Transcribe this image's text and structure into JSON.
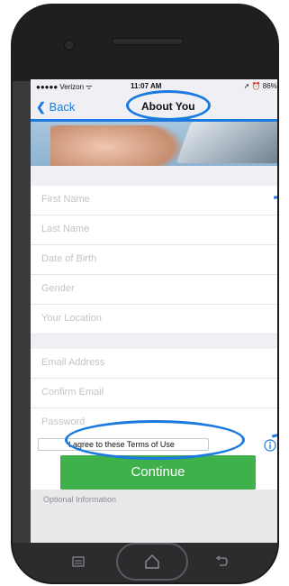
{
  "status": {
    "carrier": "●●●●● Verizon ᯤ",
    "time": "11:07 AM",
    "right": "➚ ⏰ 86% ▬"
  },
  "nav": {
    "back_label": "Back",
    "title": "About You"
  },
  "fields": {
    "first_name": "First Name",
    "last_name": "Last Name",
    "dob": "Date of Birth",
    "gender": "Gender",
    "location": "Your Location",
    "email": "Email Address",
    "confirm_email": "Confirm Email",
    "password": "Password"
  },
  "terms": {
    "label": "I agree to these Terms of Use"
  },
  "continue_label": "Continue",
  "optional_label": "Optional Information",
  "colors": {
    "accent": "#1a7ae0",
    "continue_bg": "#3fb14a",
    "placeholder": "#c4c4c8"
  },
  "icons": [
    "wifi-icon",
    "battery-icon",
    "back-chevron-icon",
    "info-icon",
    "menu-icon",
    "home-icon",
    "back-arrow-icon"
  ]
}
